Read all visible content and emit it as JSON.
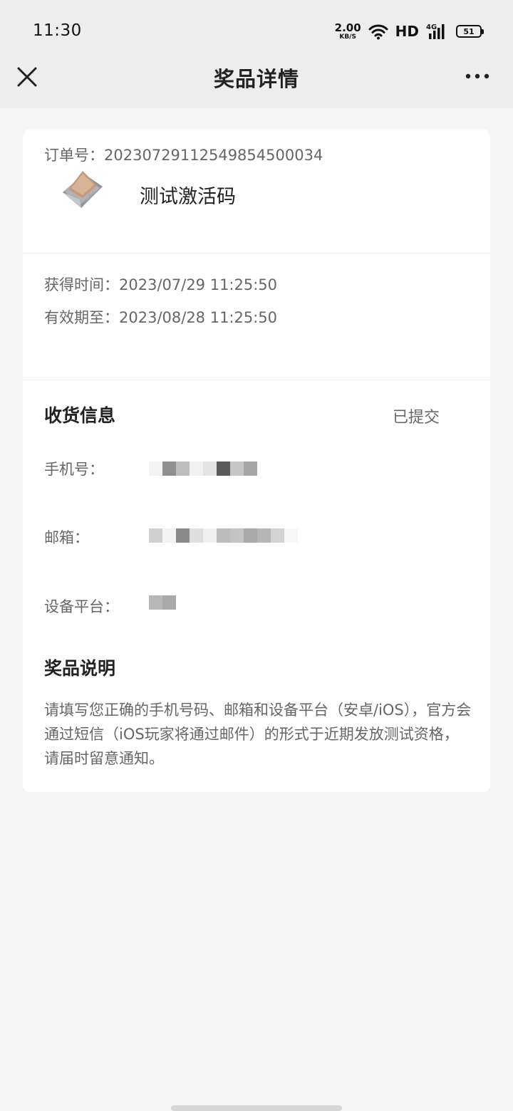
{
  "status_bar": {
    "time": "11:30",
    "net_speed_value": "2.00",
    "net_speed_unit": "KB/S",
    "hd_label": "HD",
    "network_label": "4G",
    "battery_level": "51",
    "icons": [
      "wifi-icon",
      "signal-icon",
      "battery-icon"
    ]
  },
  "nav": {
    "title": "奖品详情",
    "icons": [
      "close-icon",
      "more-icon"
    ]
  },
  "prize": {
    "name": "测试激活码",
    "icon": "envelope-icon"
  },
  "order": {
    "order_no": "订单号：20230729112549854500034",
    "obtained_time": "获得时间：2023/07/29 11:25:50",
    "valid_until": "有效期至：2023/08/28 11:25:50"
  },
  "shipping": {
    "title": "收货信息",
    "status": "已提交",
    "phone_label": "手机号：",
    "email_label": "邮箱：",
    "platform_label": "设备平台："
  },
  "description": {
    "title": "奖品说明",
    "text": "请填写您正确的手机号码、邮箱和设备平台（安卓/iOS），官方会通过短信（iOS玩家将通过邮件）的形式于近期发放测试资格，请届时留意通知。"
  },
  "colors": {
    "page_background": "#f5f5f5",
    "header_background": "#ededed",
    "card_background": "#ffffff"
  }
}
